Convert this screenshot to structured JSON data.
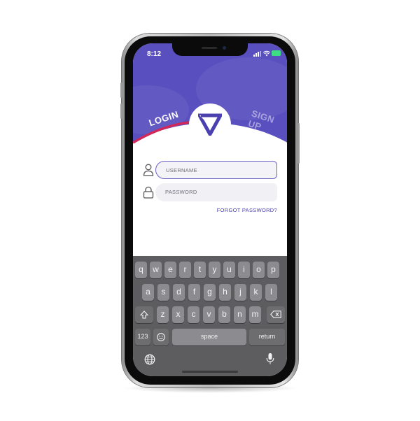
{
  "status_bar": {
    "time": "8:12"
  },
  "tabs": {
    "login": "LOGIN",
    "signup": "SIGN UP"
  },
  "form": {
    "username_placeholder": "USERNAME",
    "password_placeholder": "PASSWORD",
    "forgot_password": "FORGOT PASSWORD?"
  },
  "keyboard": {
    "row1": [
      "q",
      "w",
      "e",
      "r",
      "t",
      "y",
      "u",
      "i",
      "o",
      "p"
    ],
    "row2": [
      "a",
      "s",
      "d",
      "f",
      "g",
      "h",
      "j",
      "k",
      "l"
    ],
    "row3": [
      "z",
      "x",
      "c",
      "v",
      "b",
      "n",
      "m"
    ],
    "numbers_key": "123",
    "space_key": "space",
    "return_key": "return"
  },
  "colors": {
    "brand_purple": "#5a4fbf",
    "accent_pink": "#d0285a",
    "link_purple": "#4a40a8"
  },
  "icons": [
    "user-icon",
    "lock-icon",
    "shift-icon",
    "backspace-icon",
    "emoji-icon",
    "globe-icon",
    "microphone-icon",
    "logo-icon"
  ]
}
